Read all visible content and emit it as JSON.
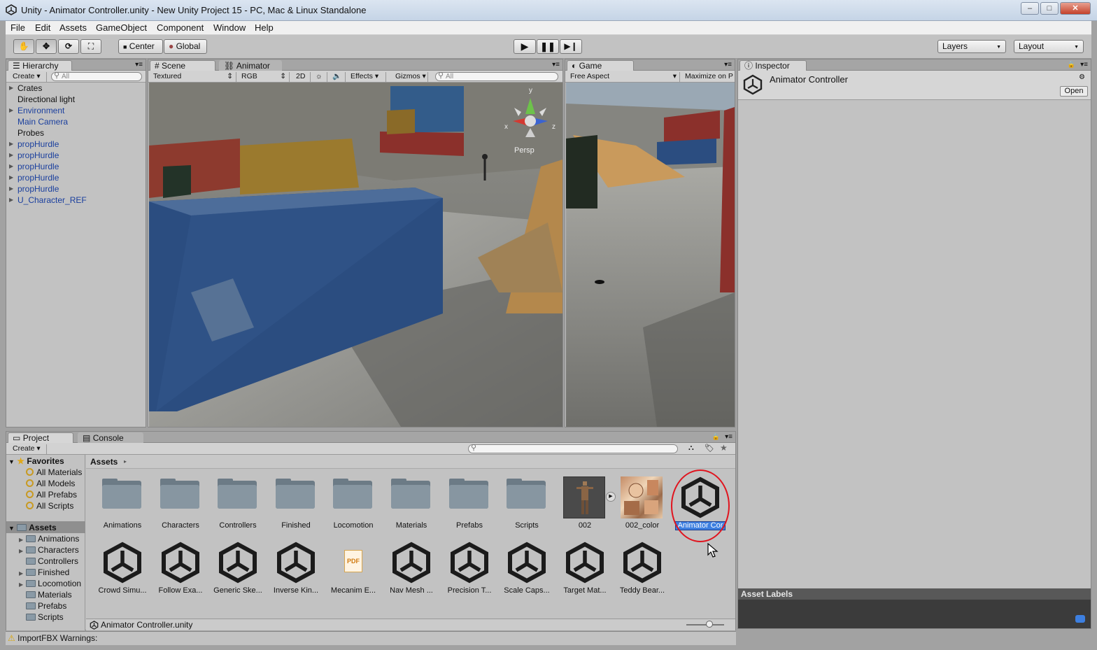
{
  "window": {
    "title": "Unity - Animator Controller.unity - New Unity Project 15 - PC, Mac & Linux Standalone",
    "minimize": "‒",
    "maximize": "□",
    "close": "✕"
  },
  "menu": [
    "File",
    "Edit",
    "Assets",
    "GameObject",
    "Component",
    "Window",
    "Help"
  ],
  "toolbar": {
    "pivot_center": "Center",
    "pivot_global": "Global",
    "layers": "Layers",
    "layout": "Layout"
  },
  "hierarchy": {
    "tab": "Hierarchy",
    "create": "Create",
    "search_placeholder": "All",
    "items": [
      {
        "label": "Crates",
        "expandable": true,
        "prefab": false
      },
      {
        "label": "Directional light",
        "expandable": false,
        "prefab": false
      },
      {
        "label": "Environment",
        "expandable": true,
        "prefab": true
      },
      {
        "label": "Main Camera",
        "expandable": false,
        "prefab": true
      },
      {
        "label": "Probes",
        "expandable": false,
        "prefab": false
      },
      {
        "label": "propHurdle",
        "expandable": true,
        "prefab": true
      },
      {
        "label": "propHurdle",
        "expandable": true,
        "prefab": true
      },
      {
        "label": "propHurdle",
        "expandable": true,
        "prefab": true
      },
      {
        "label": "propHurdle",
        "expandable": true,
        "prefab": true
      },
      {
        "label": "propHurdle",
        "expandable": true,
        "prefab": true
      },
      {
        "label": "U_Character_REF",
        "expandable": true,
        "prefab": true
      }
    ]
  },
  "scene": {
    "tab_scene": "Scene",
    "tab_animator": "Animator",
    "render_mode": "Textured",
    "color_mode": "RGB",
    "mode_2d": "2D",
    "effects": "Effects",
    "gizmos": "Gizmos",
    "search_placeholder": "All",
    "persp": "Persp",
    "axis_x": "x",
    "axis_y": "y",
    "axis_z": "z"
  },
  "game": {
    "tab": "Game",
    "aspect": "Free Aspect",
    "maximize": "Maximize on P"
  },
  "inspector": {
    "tab": "Inspector",
    "title": "Animator Controller",
    "open": "Open",
    "asset_labels": "Asset Labels"
  },
  "project": {
    "tab_project": "Project",
    "tab_console": "Console",
    "create": "Create",
    "breadcrumb": "Assets",
    "favorites_label": "Favorites",
    "favorites": [
      "All Materials",
      "All Models",
      "All Prefabs",
      "All Scripts"
    ],
    "assets_label": "Assets",
    "asset_folders": [
      {
        "label": "Animations",
        "expandable": true
      },
      {
        "label": "Characters",
        "expandable": true
      },
      {
        "label": "Controllers",
        "expandable": false
      },
      {
        "label": "Finished",
        "expandable": true
      },
      {
        "label": "Locomotion",
        "expandable": true
      },
      {
        "label": "Materials",
        "expandable": false
      },
      {
        "label": "Prefabs",
        "expandable": false
      },
      {
        "label": "Scripts",
        "expandable": false
      }
    ],
    "grid_row1": [
      "Animations",
      "Characters",
      "Controllers",
      "Finished",
      "Locomotion",
      "Materials",
      "Prefabs",
      "Scripts",
      "002",
      "002_color",
      "Animator Cor"
    ],
    "grid_row2": [
      "Crowd Simu...",
      "Follow Exa...",
      "Generic Ske...",
      "Inverse Kin...",
      "Mecanim E...",
      "Nav Mesh ...",
      "Precision T...",
      "Scale Caps...",
      "Target Mat...",
      "Teddy Bear..."
    ],
    "pdf_text": "PDF",
    "selected_path": "Animator Controller.unity"
  },
  "status": {
    "text": "ImportFBX Warnings:"
  },
  "colors": {
    "accent_selection": "#3d7fe0",
    "prefab_blue": "#1a3f9e",
    "highlight_circle": "#e0141e"
  }
}
